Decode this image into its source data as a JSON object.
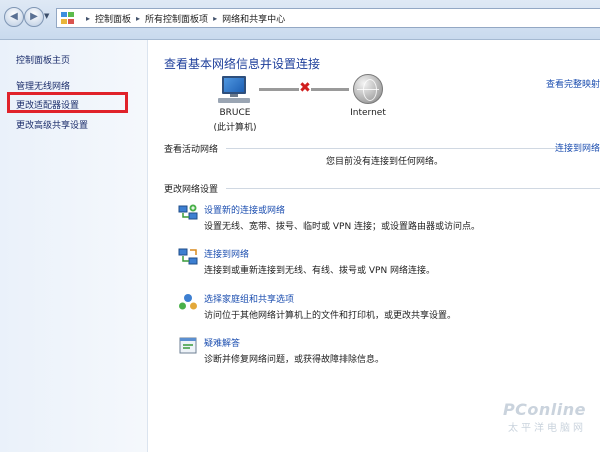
{
  "address_bar": {
    "breadcrumbs": [
      "控制面板",
      "所有控制面板项",
      "网络和共享中心"
    ],
    "separator": "▸"
  },
  "sidebar": {
    "items": [
      {
        "label": "控制面板主页"
      },
      {
        "label": "管理无线网络"
      },
      {
        "label": "更改适配器设置",
        "highlighted": true
      },
      {
        "label": "更改高级共享设置"
      }
    ]
  },
  "main": {
    "title": "查看基本网络信息并设置连接",
    "full_map_link": "查看完整映射",
    "network_map": {
      "computer_name": "BRUCE",
      "computer_sub": "(此计算机)",
      "internet_label": "Internet",
      "status": "disconnected"
    },
    "active_section": {
      "heading": "查看活动网络",
      "connect_link": "连接到网络",
      "empty_message": "您目前没有连接到任何网络。"
    },
    "change_section": {
      "heading": "更改网络设置",
      "tasks": [
        {
          "title": "设置新的连接或网络",
          "desc": "设置无线、宽带、拨号、临时或 VPN 连接；或设置路由器或访问点。",
          "icon": "new-connection-icon"
        },
        {
          "title": "连接到网络",
          "desc": "连接到或重新连接到无线、有线、拨号或 VPN 网络连接。",
          "icon": "connect-network-icon"
        },
        {
          "title": "选择家庭组和共享选项",
          "desc": "访问位于其他网络计算机上的文件和打印机，或更改共享设置。",
          "icon": "homegroup-icon"
        },
        {
          "title": "疑难解答",
          "desc": "诊断并修复网络问题，或获得故障排除信息。",
          "icon": "troubleshoot-icon"
        }
      ]
    }
  },
  "watermark": {
    "brand": "PConline",
    "sub": "太平洋电脑网"
  },
  "colors": {
    "link": "#1d4fb0",
    "title": "#1e3f9b",
    "highlight": "#e0222a",
    "error_x": "#d11f1f"
  }
}
